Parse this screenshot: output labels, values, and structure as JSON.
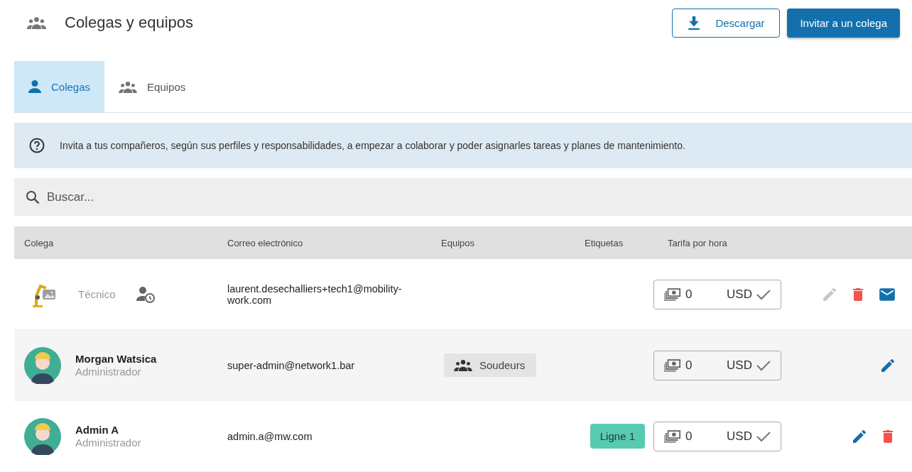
{
  "header": {
    "title": "Colegas y equipos",
    "buttons": [
      {
        "kind": "outline",
        "label": "Descargar"
      },
      {
        "kind": "primary",
        "label": "Invitar a un colega"
      }
    ]
  },
  "tabs": [
    {
      "label": "Colegas",
      "kind": "person",
      "selected": true
    },
    {
      "label": "Equipos",
      "kind": "group",
      "selected": false
    }
  ],
  "info": {
    "text": "Invita a tus compañeros, según sus perfiles y responsabilidades, a empezar a colaborar y poder asignarles tareas y planes de mantenimiento."
  },
  "search": {
    "placeholder": "Buscar..."
  },
  "table": {
    "columns": [
      "Colega",
      "Correo electrónico",
      "Equipos",
      "Etiquetas",
      "Tarifa por hora"
    ],
    "rows": [
      {
        "kind": "machine",
        "role": "Técnico",
        "pending": true,
        "email": "laurent.desechalliers+tech1@mobility-work.com",
        "teams": [],
        "tags": [],
        "rate": "0",
        "currency": "USD",
        "actions": [
          {
            "kind": "edit",
            "disabled": true
          },
          {
            "kind": "delete",
            "disabled": false
          },
          {
            "kind": "mail",
            "disabled": false
          }
        ]
      },
      {
        "kind": "person",
        "name": "Morgan Watsica",
        "role": "Administrador",
        "pending": false,
        "email": "super-admin@network1.bar",
        "teams": [
          "Soudeurs"
        ],
        "tags": [],
        "rate": "0",
        "currency": "USD",
        "actions": [
          {
            "kind": "edit",
            "disabled": false
          }
        ]
      },
      {
        "kind": "person",
        "name": "Admin A",
        "role": "Administrador",
        "pending": false,
        "email": "admin.a@mw.com",
        "teams": [],
        "tags": [
          {
            "label": "Ligne 1",
            "color": "#57cbb1"
          }
        ],
        "rate": "0",
        "currency": "USD",
        "actions": [
          {
            "kind": "edit",
            "disabled": false
          },
          {
            "kind": "delete",
            "disabled": false
          }
        ]
      }
    ]
  }
}
